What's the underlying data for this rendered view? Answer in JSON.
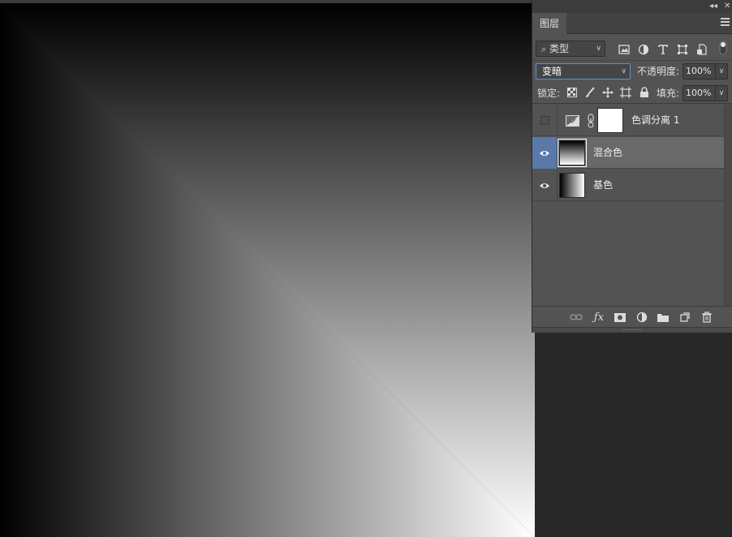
{
  "panel": {
    "tab_label": "图层",
    "filter": {
      "label": "类型",
      "icons": [
        "image-filter-icon",
        "adjustment-filter-icon",
        "type-filter-icon",
        "shape-filter-icon",
        "smart-object-filter-icon",
        "filter-toggle-icon"
      ]
    },
    "blend_mode": "变暗",
    "opacity": {
      "label": "不透明度:",
      "value": "100%"
    },
    "lock": {
      "label": "锁定:",
      "icons": [
        "lock-transparent-icon",
        "lock-image-icon",
        "lock-position-icon",
        "lock-artboard-icon",
        "lock-all-icon"
      ]
    },
    "fill": {
      "label": "填充:",
      "value": "100%"
    },
    "layers": [
      {
        "name": "色调分离 1",
        "visible": false,
        "selected": false,
        "type": "adjustment"
      },
      {
        "name": "混合色",
        "visible": true,
        "selected": true,
        "type": "gradient-vertical"
      },
      {
        "name": "基色",
        "visible": true,
        "selected": false,
        "type": "gradient-horizontal"
      }
    ],
    "bottom_icons": [
      "link-layers-icon",
      "fx-icon",
      "mask-icon",
      "new-adjustment-icon",
      "new-group-icon",
      "new-layer-icon",
      "delete-icon"
    ]
  },
  "colors": {
    "panel_bg": "#535353",
    "selected_row": "#696969",
    "selected_eye_bg": "#5a78a8",
    "blend_border": "#5b8dd3",
    "app_bg": "#282828"
  }
}
